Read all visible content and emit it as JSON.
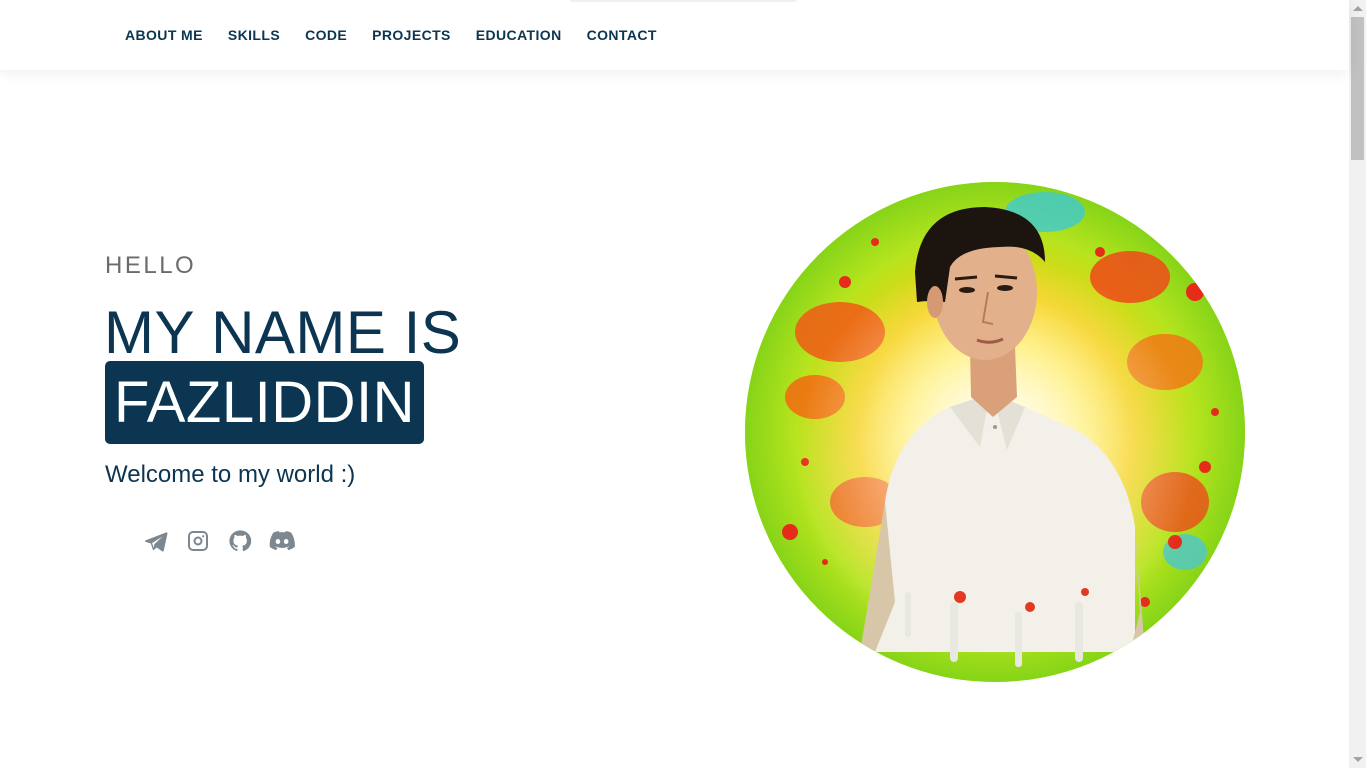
{
  "nav": {
    "items": [
      {
        "label": "ABOUT ME"
      },
      {
        "label": "SKILLS"
      },
      {
        "label": "CODE"
      },
      {
        "label": "PROJECTS"
      },
      {
        "label": "EDUCATION"
      },
      {
        "label": "CONTACT"
      }
    ]
  },
  "hero": {
    "greeting": "HELLO",
    "intro": "MY NAME IS",
    "name": "FAZLIDDIN",
    "tagline": "Welcome to my world :)"
  },
  "socials": [
    {
      "icon": "telegram-icon"
    },
    {
      "icon": "instagram-icon"
    },
    {
      "icon": "github-icon"
    },
    {
      "icon": "discord-icon"
    }
  ],
  "colors": {
    "primary": "#0b3550",
    "greeting": "#6b6b6b",
    "icon": "#7d8790",
    "background": "#ffffff"
  }
}
